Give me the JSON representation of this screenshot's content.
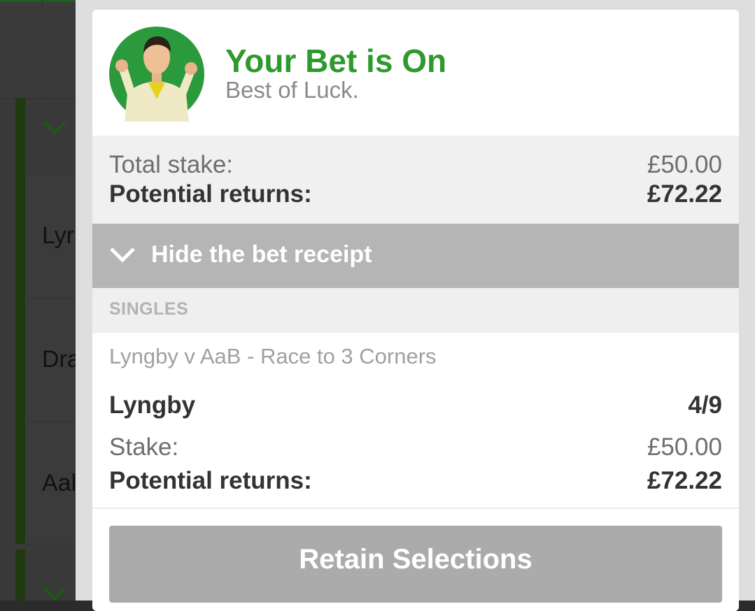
{
  "background": {
    "rows": [
      "Lyr",
      "Dra",
      "Aal"
    ]
  },
  "receipt": {
    "title": "Your Bet is On",
    "subtitle": "Best of Luck.",
    "avatar_icon": "cheering-man-icon",
    "totals": {
      "stake_label": "Total stake:",
      "stake_value": "£50.00",
      "returns_label": "Potential returns:",
      "returns_value": "£72.22"
    },
    "hide_label": "Hide the bet receipt",
    "section_label": "SINGLES",
    "bets": [
      {
        "event": "Lyngby v AaB - Race to 3 Corners",
        "selection": "Lyngby",
        "odds": "4/9",
        "stake_label": "Stake:",
        "stake_value": "£50.00",
        "returns_label": "Potential returns:",
        "returns_value": "£72.22"
      }
    ],
    "retain_label": "Retain Selections"
  },
  "colors": {
    "accent_green": "#2e9a2e",
    "button_grey": "#ababab"
  }
}
